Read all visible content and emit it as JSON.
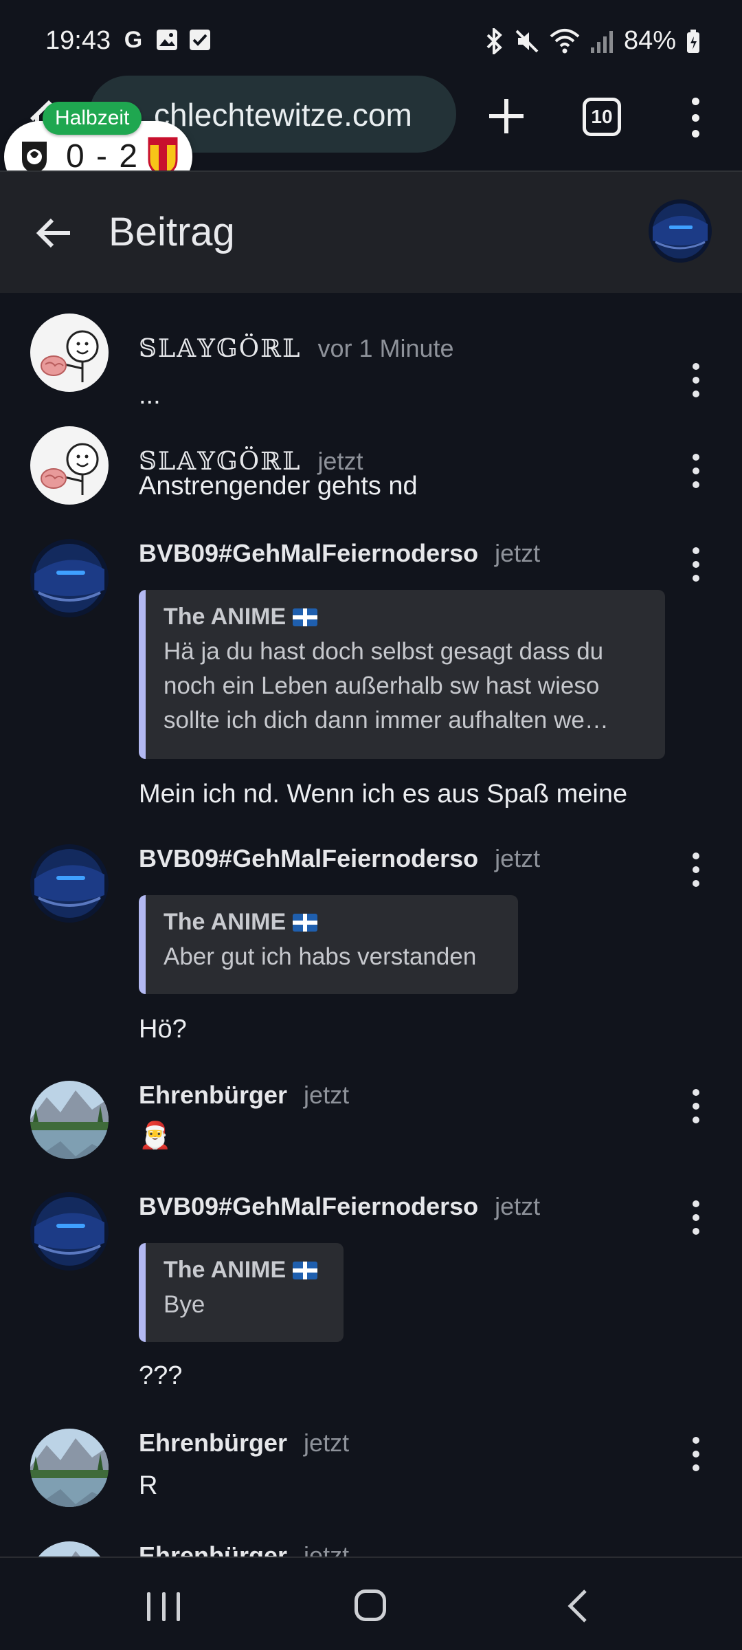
{
  "status_bar": {
    "time": "19:43",
    "battery": "84%",
    "left_icons": [
      "google-icon",
      "gallery-icon",
      "checkbox-icon"
    ],
    "right_icons": [
      "bluetooth-icon",
      "mute-icon",
      "wifi-icon",
      "signal-icon",
      "battery-icon"
    ]
  },
  "browser": {
    "url": "chlechtewitze.com",
    "tab_count": "10"
  },
  "score_widget": {
    "status": "Halbzeit",
    "result": "0 - 2"
  },
  "header": {
    "title": "Beitrag"
  },
  "messages": [
    {
      "author": "𝕊𝕃𝔸𝕐𝔾Öℝ𝕃",
      "time": "vor 1 Minute",
      "text": "...",
      "avatar": "meme-avatar"
    },
    {
      "author": "𝕊𝕃𝔸𝕐𝔾Öℝ𝕃",
      "time": "jetzt",
      "text": "Anstrengender gehts nd",
      "avatar": "meme-avatar"
    },
    {
      "author": "BVB09#GehMalFeiernoderso",
      "time": "jetzt",
      "avatar": "car-avatar",
      "quote": {
        "author": "The ANIME",
        "lines": [
          "Hä ja du hast doch selbst gesagt dass du",
          "noch ein Leben außerhalb sw hast wieso",
          "sollte ich dich dann immer aufhalten we…"
        ]
      },
      "text": "Mein ich nd. Wenn ich es aus Spaß meine"
    },
    {
      "author": "BVB09#GehMalFeiernoderso",
      "time": "jetzt",
      "avatar": "car-avatar",
      "quote": {
        "author": "The ANIME",
        "lines": [
          "Aber gut ich habs verstanden"
        ]
      },
      "text": "Hö?"
    },
    {
      "author": "Ehrenbürger",
      "time": "jetzt",
      "text": "🎅",
      "avatar": "landscape-avatar"
    },
    {
      "author": "BVB09#GehMalFeiernoderso",
      "time": "jetzt",
      "avatar": "car-avatar",
      "quote": {
        "author": "The ANIME",
        "lines": [
          "Bye"
        ]
      },
      "text": "???"
    },
    {
      "author": "Ehrenbürger",
      "time": "jetzt",
      "text": "R",
      "avatar": "landscape-avatar"
    },
    {
      "author": "Ehrenbürger",
      "time": "jetzt",
      "text": "",
      "avatar": "landscape-avatar"
    }
  ]
}
